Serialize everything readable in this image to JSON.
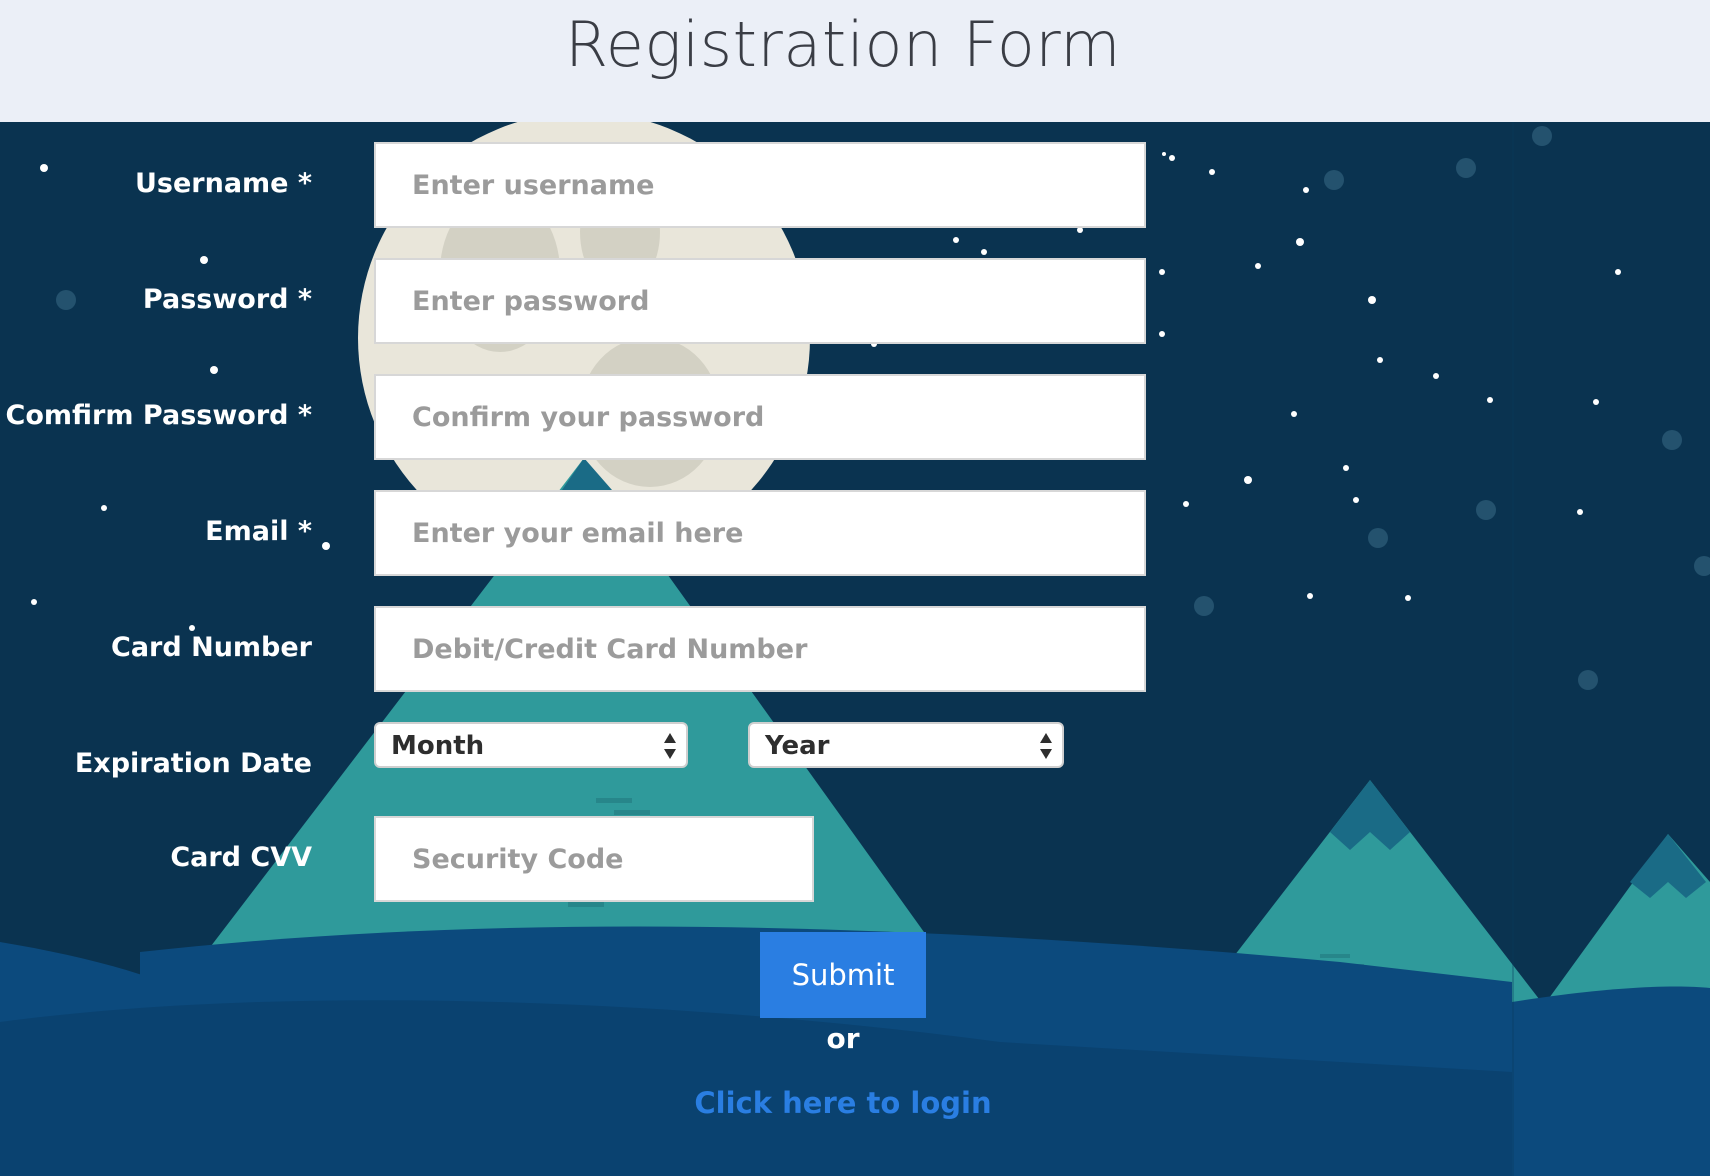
{
  "header": {
    "title": "Registration Form"
  },
  "form": {
    "username": {
      "label": "Username *",
      "placeholder": "Enter username",
      "value": ""
    },
    "password": {
      "label": "Password *",
      "placeholder": "Enter password",
      "value": ""
    },
    "confirm_password": {
      "label": "Comfirm Password *",
      "placeholder": "Confirm your password",
      "value": ""
    },
    "email": {
      "label": "Email *",
      "placeholder": "Enter your email here",
      "value": ""
    },
    "card_number": {
      "label": "Card Number",
      "placeholder": "Debit/Credit Card Number",
      "value": ""
    },
    "expiration": {
      "label": "Expiration Date",
      "month_selected": "Month",
      "year_selected": "Year"
    },
    "cvv": {
      "label": "Card CVV",
      "placeholder": "Security Code",
      "value": ""
    },
    "submit_label": "Submit",
    "or_text": "or",
    "login_link": "Click here to login"
  },
  "colors": {
    "header_bg": "#ebeff7",
    "night_sky": "#0a3350",
    "mountain": "#2f9a9b",
    "hills": "#0c4a7d",
    "accent": "#2a7ee2",
    "moon": "#e9e6da"
  },
  "icons": {
    "select_arrows": "updown-arrows-icon"
  }
}
